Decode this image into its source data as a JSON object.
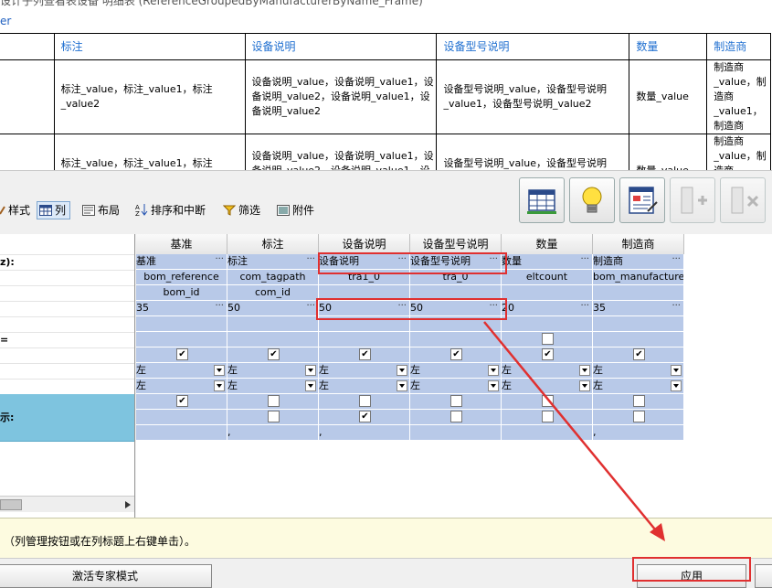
{
  "window": {
    "title_fragment": "设计子列查看表设备 明细表 (ReferenceGroupedByManufacturerByName_Frame)",
    "path_fragment": "er"
  },
  "preview_table": {
    "headers": [
      "",
      "标注",
      "设备说明",
      "设备型号说明",
      "数量",
      "制造商"
    ],
    "rows": [
      [
        "",
        "标注_value，标注_value1，标注_value2",
        "设备说明_value，设备说明_value1，设备说明_value2，设备说明_value1，设备说明_value2",
        "设备型号说明_value，设备型号说明_value1，设备型号说明_value2",
        "数量_value",
        "制造商_value，制造商_value1，制造商"
      ],
      [
        "",
        "标注_value，标注_value1，标注_value2",
        "设备说明_value，设备说明_value1，设备说明_value2，设备说明_value1，设备说明_value2",
        "设备型号说明_value，设备型号说明_value1，设备型号说明_value2",
        "数量_value",
        "制造商_value，制造商_value1，制造商"
      ]
    ]
  },
  "tabs": [
    {
      "label": "样式",
      "icon": "style-icon"
    },
    {
      "label": "列",
      "icon": "table-columns-icon"
    },
    {
      "label": "布局",
      "icon": "layout-icon"
    },
    {
      "label": "排序和中断",
      "icon": "sort-az-icon"
    },
    {
      "label": "筛选",
      "icon": "filter-icon"
    },
    {
      "label": "附件",
      "icon": "attachment-icon"
    }
  ],
  "left_panel": {
    "rows": [
      {
        "label": "",
        "blue": false
      },
      {
        "label": "z):",
        "blue": false
      },
      {
        "label": "",
        "blue": false
      },
      {
        "label": "",
        "blue": false
      },
      {
        "label": "",
        "blue": false
      },
      {
        "label": "",
        "blue": false
      },
      {
        "label": "=",
        "blue": false
      },
      {
        "label": "",
        "blue": false
      },
      {
        "label": "",
        "blue": false
      },
      {
        "label": "",
        "blue": false
      },
      {
        "label": "",
        "blue": true
      },
      {
        "label": "示:",
        "blue": true
      },
      {
        "label": "",
        "blue": true
      }
    ]
  },
  "grid": {
    "columns": [
      "基准",
      "标注",
      "设备说明",
      "设备型号说明",
      "数量",
      "制造商"
    ],
    "header_names": [
      "基准",
      "标注",
      "设备说明",
      "设备型号说明",
      "数量",
      "制造商"
    ],
    "properties": [
      "bom_reference",
      "com_tagpath",
      "tra1_0",
      "tra_0",
      "eltcount",
      "bom_manufacturer"
    ],
    "keys": [
      "bom_id",
      "com_id"
    ],
    "widths": [
      "35",
      "50",
      "50",
      "50",
      "20",
      "35"
    ],
    "align1": [
      "左",
      "左",
      "左",
      "左",
      "左",
      "左"
    ],
    "align2": [
      "左",
      "左",
      "左",
      "左",
      "左",
      "左"
    ],
    "separators": [
      "",
      ",",
      ",",
      "",
      "",
      ","
    ]
  },
  "status": {
    "hint": "（列管理按钮或在列标题上右键单击）。"
  },
  "bottom": {
    "expert_mode": "激活专家模式",
    "apply": "应用"
  }
}
